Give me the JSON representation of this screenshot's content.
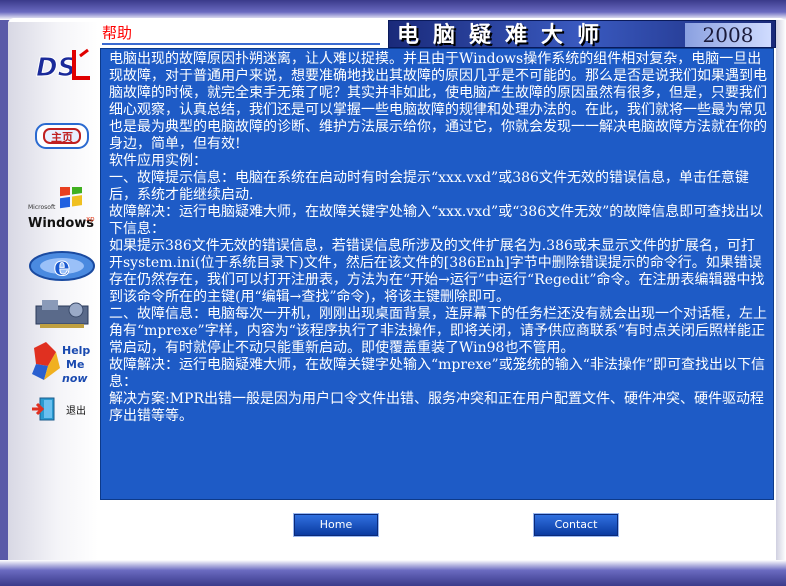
{
  "header": {
    "help_label": "帮助",
    "banner_title": "电脑疑难大师",
    "banner_year": "2008"
  },
  "sidebar": {
    "items": [
      {
        "name": "ds-logo",
        "label": "DS"
      },
      {
        "name": "home",
        "label": "主页"
      },
      {
        "name": "windows-xp",
        "label": "Windows"
      },
      {
        "name": "ie",
        "label": "e"
      },
      {
        "name": "hardware",
        "label": ""
      },
      {
        "name": "help-me-now",
        "label": "Help Me Now"
      },
      {
        "name": "exit",
        "label": "退出"
      }
    ]
  },
  "content": {
    "paragraphs": [
      "    电脑出现的故障原因扑朔迷离，让人难以捉摸。并且由于Windows操作系统的组件相对复杂，电脑一旦出现故障，对于普通用户来说，想要准确地找出其故障的原因几乎是不可能的。那么是否是说我们如果遇到电脑故障的时候，就完全束手无策了呢？其实并非如此，使电脑产生故障的原因虽然有很多，但是，只要我们细心观察，认真总结，我们还是可以掌握一些电脑故障的规律和处理办法的。在此，我们就将一些最为常见也是最为典型的电脑故障的诊断、维护方法展示给你，通过它，你就会发现一一解决电脑故障方法就在你的身边，简单，但有效!",
      "    软件应用实例：",
      "    一、故障提示信息：电脑在系统在启动时有时会提示“xxx.vxd”或386文件无效的错误信息，单击任意键后，系统才能继续启动.",
      "        故障解决：运行电脑疑难大师，在故障关键字处输入“xxx.vxd”或“386文件无效”的故障信息即可查找出以下信息：",
      "        如果提示386文件无效的错误信息，若错误信息所涉及的文件扩展名为.386或未显示文件的扩展名，可打开system.ini(位于系统目录下)文件，然后在该文件的[386Enh]字节中删除错误提示的命令行。如果错误存在仍然存在，我们可以打开注册表，方法为在“开始→运行”中运行“Regedit”命令。在注册表编辑器中找到该命令所在的主键(用“编辑→查找”命令)，将该主键删除即可。",
      "    二、故障信息：电脑每次一开机，刚刚出现桌面背景，连屏幕下的任务栏还没有就会出现一个对话框，左上角有“mprexe”字样，内容为“该程序执行了非法操作，即将关闭，请予供应商联系”有时点关闭后照样能正常启动，有时就停止不动只能重新启动。即使覆盖重装了Win98也不管用。",
      "        故障解决：运行电脑疑难大师，在故障关键字处输入“mprexe”或笼统的输入“非法操作”即可查找出以下信息：",
      "        解决方案:MPR出错一般是因为用户口令文件出错、服务冲突和正在用户配置文件、硬件冲突、硬件驱动程序出错等等。"
    ]
  },
  "footer": {
    "home_label": "Home",
    "contact_label": "Contact"
  },
  "colors": {
    "content_bg": "#1e5bc6",
    "help_red": "#ff0000",
    "frame_purple": "#5a5aa8"
  }
}
